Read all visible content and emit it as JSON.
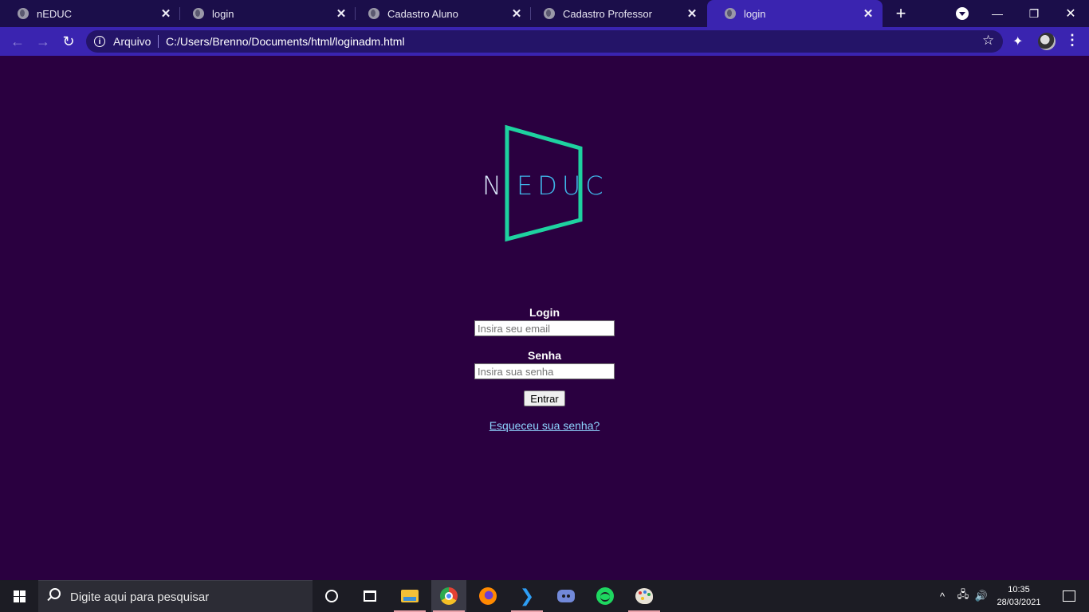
{
  "tabs": [
    {
      "title": "nEDUC",
      "close": "✕"
    },
    {
      "title": "login",
      "close": "✕"
    },
    {
      "title": "Cadastro Aluno",
      "close": "✕"
    },
    {
      "title": "Cadastro Professor",
      "close": "✕"
    },
    {
      "title": "login",
      "close": "✕"
    }
  ],
  "new_tab": "+",
  "window_controls": {
    "minimize": "—",
    "restore": "❐",
    "close": "✕"
  },
  "nav": {
    "back": "←",
    "forward": "→",
    "reload": "↻"
  },
  "address": {
    "scheme_label": "Arquivo",
    "url": "C:/Users/Brenno/Documents/html/loginadm.html",
    "info_glyph": "i"
  },
  "toolbar_icons": {
    "star": "☆",
    "extensions": "✦",
    "menu": "⋮"
  },
  "logo": {
    "letter_n": "N",
    "letters": "EDUC",
    "frame_color": "#1ed2a0",
    "n_color": "#d8e4f8",
    "letters_color": "#3fb5e8"
  },
  "form": {
    "login_label": "Login",
    "login_placeholder": "Insira seu email",
    "senha_label": "Senha",
    "senha_placeholder": "Insira sua senha",
    "submit_label": "Entrar",
    "forgot_link": "Esqueceu sua senha?"
  },
  "colors": {
    "page_background": "#2a0040",
    "browser_accent": "#3a24b0",
    "link": "#8fd4ff"
  },
  "taskbar": {
    "search_placeholder": "Digite aqui para pesquisar",
    "apps": [
      "cortana-icon",
      "task-view-icon",
      "file-explorer-icon",
      "chrome-icon",
      "firefox-icon",
      "vscode-icon",
      "discord-icon",
      "spotify-icon",
      "paint-icon"
    ],
    "tray": {
      "chevron": "^",
      "network": "🖧",
      "volume": "🔊"
    },
    "time": "10:35",
    "date": "28/03/2021"
  }
}
